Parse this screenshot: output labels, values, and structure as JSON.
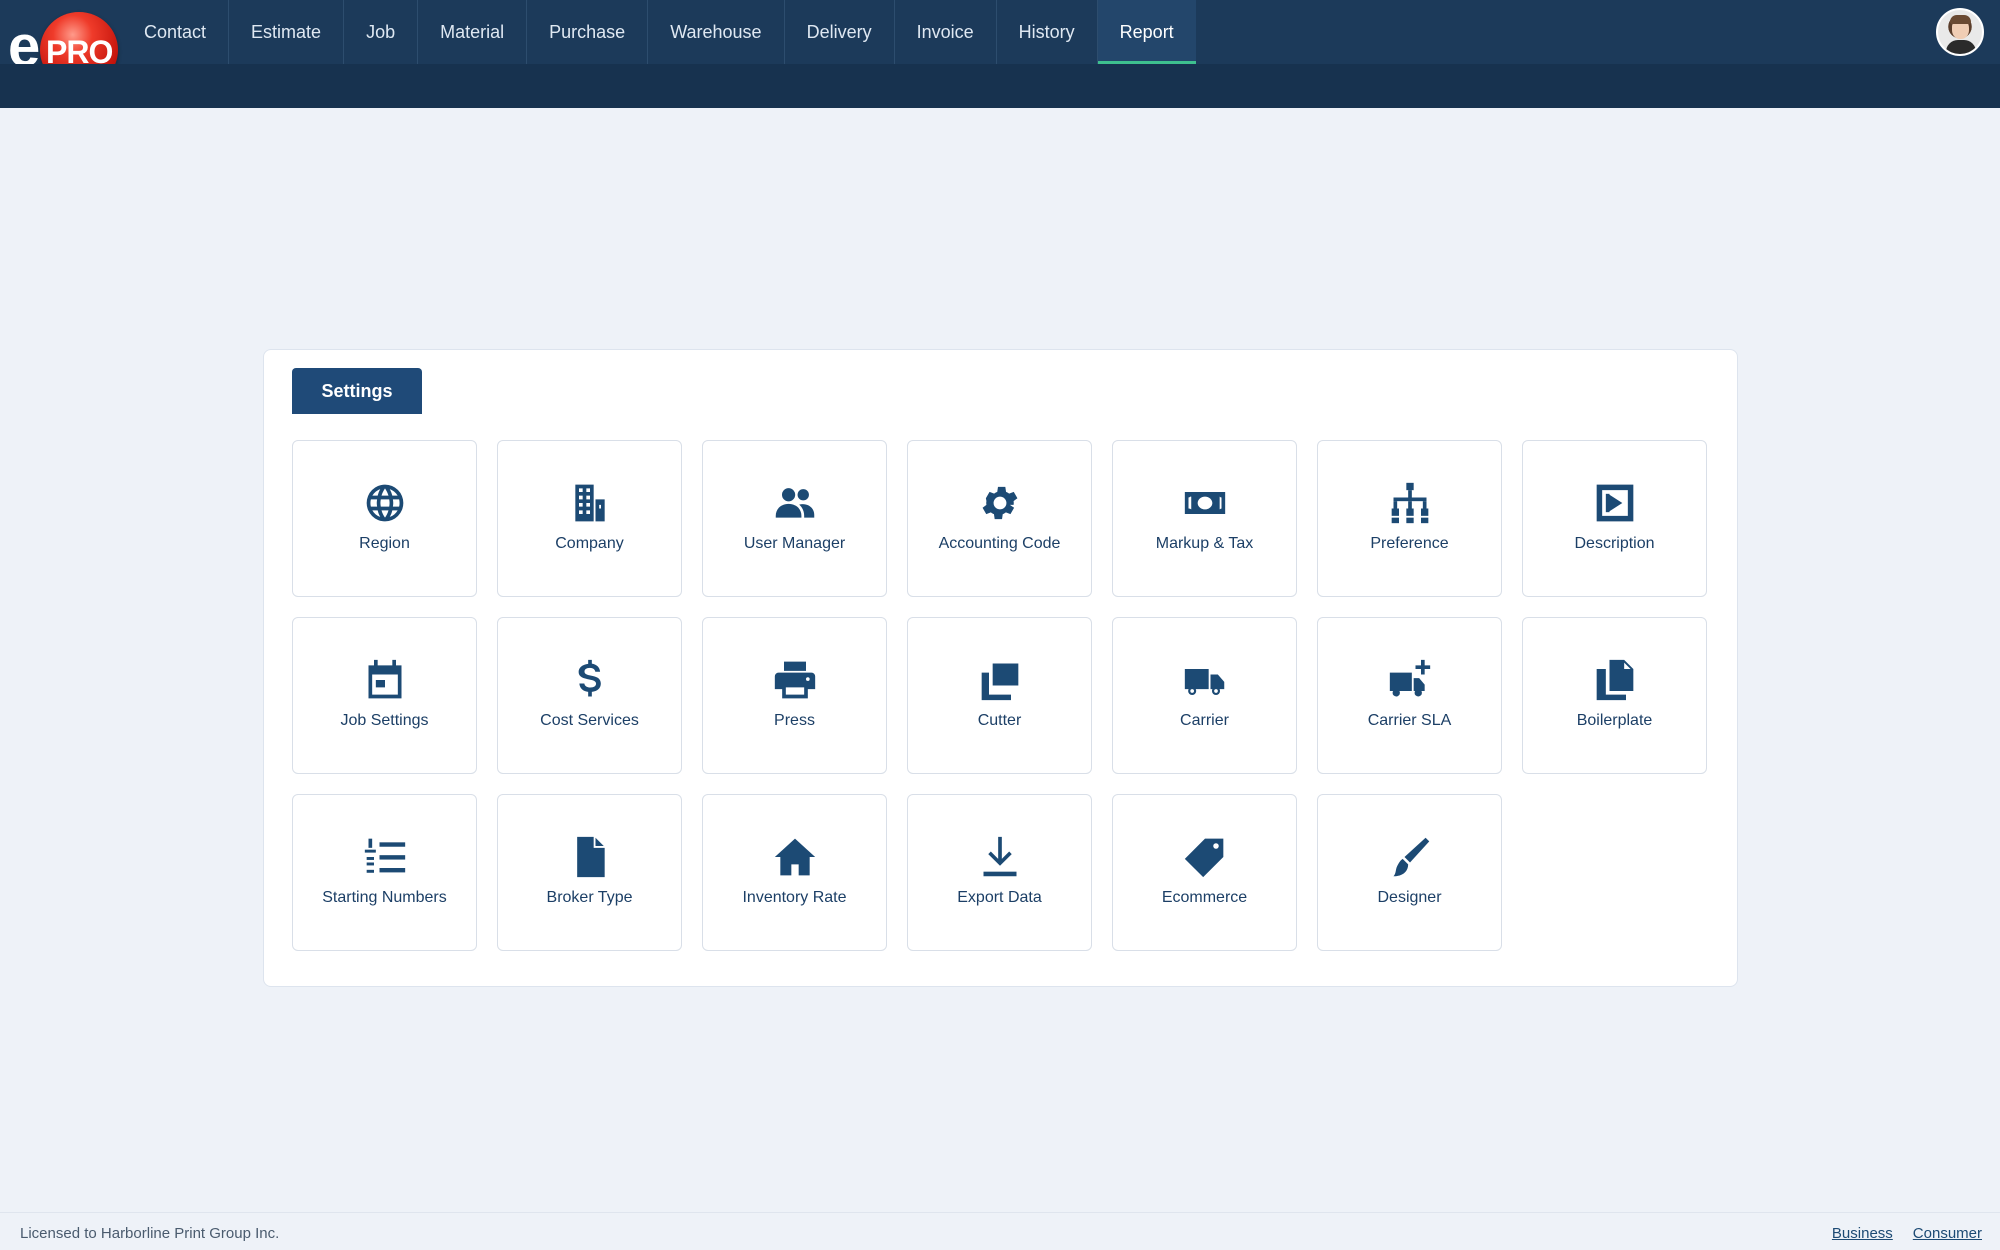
{
  "app": {
    "logo_e": "e",
    "logo_pro": "PRO"
  },
  "nav": {
    "items": [
      "Contact",
      "Estimate",
      "Job",
      "Material",
      "Purchase",
      "Warehouse",
      "Delivery",
      "Invoice",
      "History",
      "Report"
    ],
    "active": "Report"
  },
  "panel": {
    "tab_label": "Settings",
    "tiles": [
      {
        "label": "Region",
        "icon": "globe-icon"
      },
      {
        "label": "Company",
        "icon": "building-icon"
      },
      {
        "label": "User Manager",
        "icon": "users-icon"
      },
      {
        "label": "Accounting Code",
        "icon": "gear-icon"
      },
      {
        "label": "Markup & Tax",
        "icon": "money-icon"
      },
      {
        "label": "Preference",
        "icon": "sitemap-icon"
      },
      {
        "label": "Description",
        "icon": "caret-square-icon"
      },
      {
        "label": "Job Settings",
        "icon": "calendar-icon"
      },
      {
        "label": "Cost Services",
        "icon": "dollar-icon"
      },
      {
        "label": "Press",
        "icon": "printer-icon"
      },
      {
        "label": "Cutter",
        "icon": "crop-icon"
      },
      {
        "label": "Carrier",
        "icon": "truck-icon"
      },
      {
        "label": "Carrier SLA",
        "icon": "truck-plus-icon"
      },
      {
        "label": "Boilerplate",
        "icon": "copy-icon"
      },
      {
        "label": "Starting Numbers",
        "icon": "list-numbered-icon"
      },
      {
        "label": "Broker Type",
        "icon": "file-icon"
      },
      {
        "label": "Inventory Rate",
        "icon": "home-icon"
      },
      {
        "label": "Export Data",
        "icon": "download-icon"
      },
      {
        "label": "Ecommerce",
        "icon": "tag-icon"
      },
      {
        "label": "Designer",
        "icon": "paintbrush-icon"
      }
    ]
  },
  "footer": {
    "license": "Licensed to Harborline Print Group Inc.",
    "links": [
      "Business",
      "Consumer"
    ]
  },
  "colors": {
    "nav_bg": "#1c3a5a",
    "accent": "#3ec08f",
    "tab_bg": "#1f4a78",
    "icon": "#1c4a74"
  }
}
